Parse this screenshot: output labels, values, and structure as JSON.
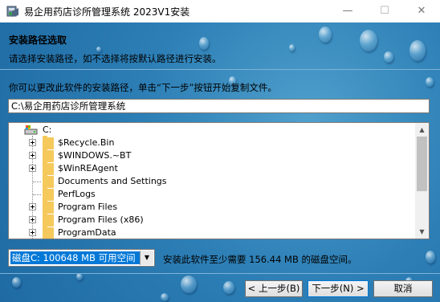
{
  "window": {
    "title": "易企用药店诊所管理系统 2023V1安装",
    "minimize_glyph": "—",
    "maximize_glyph": "☐",
    "close_glyph": "✕"
  },
  "header": {
    "title": "安装路径选取",
    "subtitle": "请选择安装路径，如不选择将按默认路径进行安装。"
  },
  "instruction": "你可以更改此软件的安装路径，单击“下一步”按钮开始复制文件。",
  "path_input": {
    "value": "C:\\易企用药店诊所管理系统"
  },
  "tree": {
    "drive_label": "C:",
    "items": [
      {
        "label": "$Recycle.Bin",
        "expandable": true
      },
      {
        "label": "$WINDOWS.~BT",
        "expandable": true
      },
      {
        "label": "$WinREAgent",
        "expandable": true
      },
      {
        "label": "Documents and Settings",
        "expandable": false
      },
      {
        "label": "PerfLogs",
        "expandable": false
      },
      {
        "label": "Program Files",
        "expandable": true
      },
      {
        "label": "Program Files (x86)",
        "expandable": true
      },
      {
        "label": "ProgramData",
        "expandable": true
      }
    ]
  },
  "drive_select": {
    "value": "磁盘C:   100648 MB 可用空间"
  },
  "space_required": "安装此软件至少需要 156.44 MB 的磁盘空间。",
  "buttons": {
    "back": "< 上一步(B)",
    "next": "下一步(N) >",
    "cancel": "取消"
  },
  "colors": {
    "background": "#2d7fb6",
    "selection": "#0078d7",
    "folder": "#f5c95b"
  }
}
